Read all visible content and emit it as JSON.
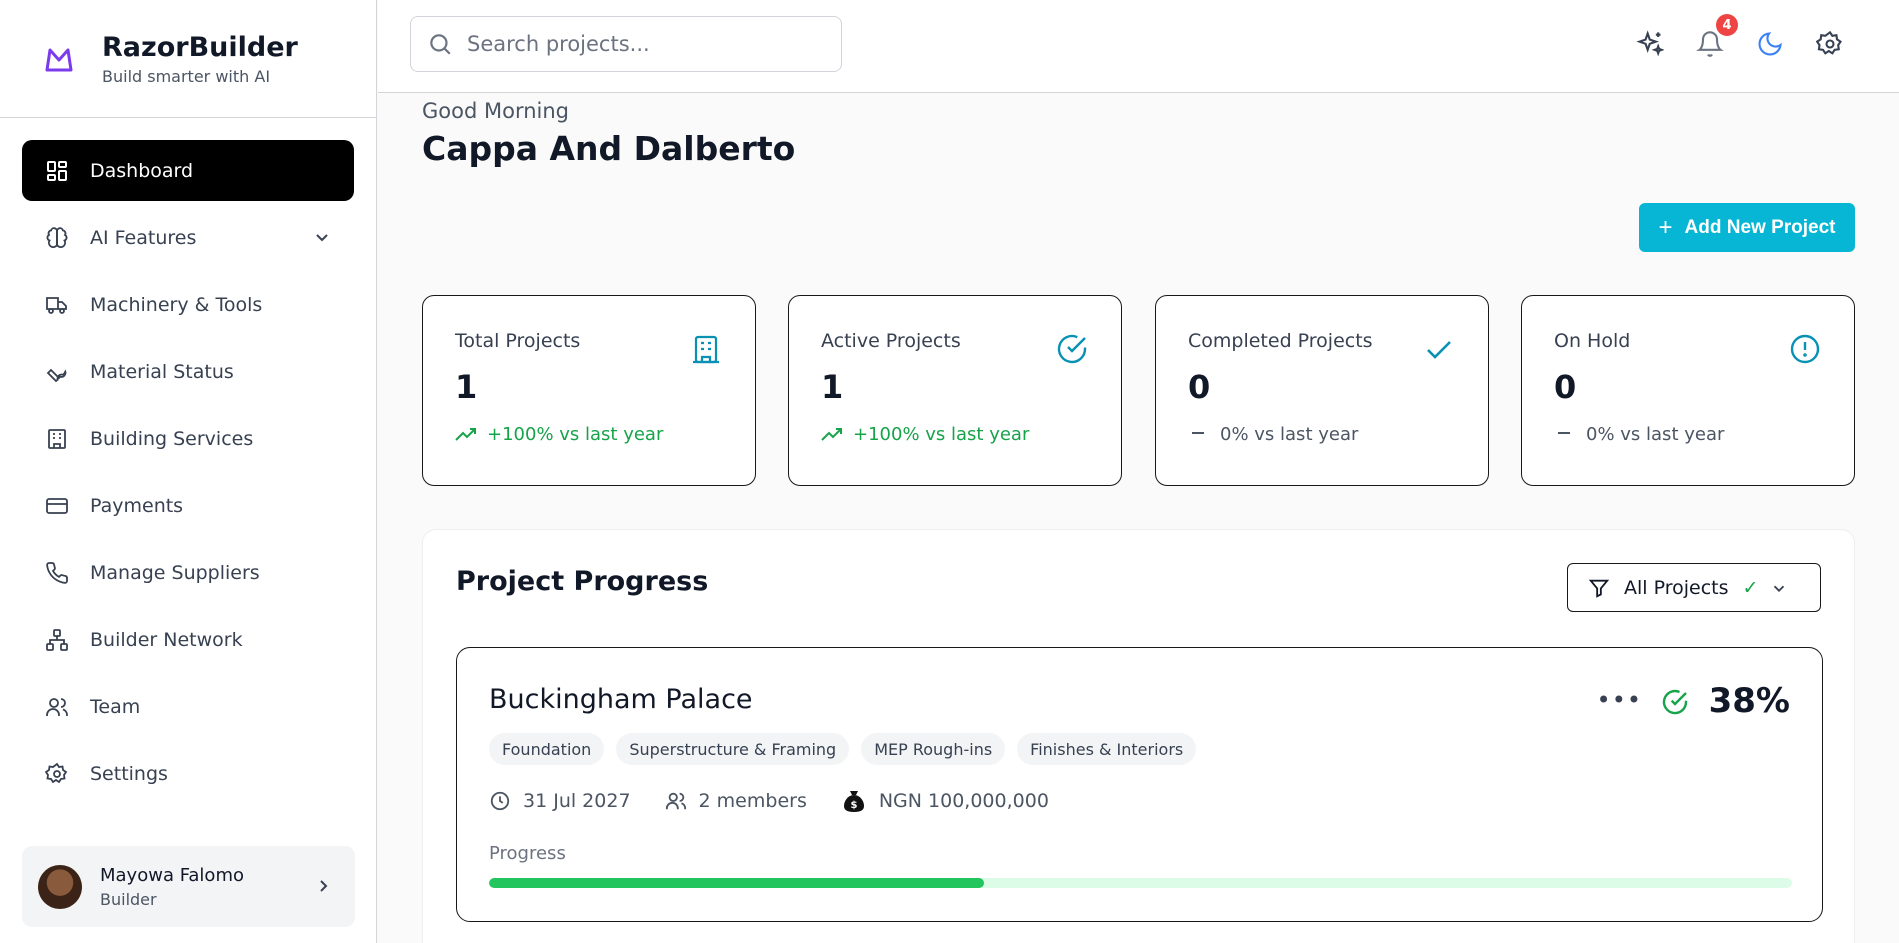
{
  "brand": {
    "name": "RazorBuilder",
    "tagline": "Build smarter with AI"
  },
  "sidebar": {
    "items": [
      {
        "label": "Dashboard",
        "icon": "dashboard-icon",
        "active": true
      },
      {
        "label": "AI Features",
        "icon": "brain-icon",
        "expandable": true
      },
      {
        "label": "Machinery & Tools",
        "icon": "truck-icon"
      },
      {
        "label": "Material Status",
        "icon": "wrench-icon"
      },
      {
        "label": "Building Services",
        "icon": "building-icon"
      },
      {
        "label": "Payments",
        "icon": "credit-card-icon"
      },
      {
        "label": "Manage Suppliers",
        "icon": "phone-icon"
      },
      {
        "label": "Builder Network",
        "icon": "network-icon"
      },
      {
        "label": "Team",
        "icon": "users-icon"
      },
      {
        "label": "Settings",
        "icon": "gear-icon"
      }
    ]
  },
  "user": {
    "name": "Mayowa Falomo",
    "role": "Builder"
  },
  "header": {
    "search_placeholder": "Search projects...",
    "notification_count": "4"
  },
  "main": {
    "greeting": "Good Morning",
    "title": "Cappa And Dalberto",
    "add_button_label": "Add New Project",
    "stats": [
      {
        "label": "Total Projects",
        "value": "1",
        "trend": "+100% vs last year",
        "trend_type": "up",
        "icon": "building-icon",
        "icon_color": "#0891b2"
      },
      {
        "label": "Active Projects",
        "value": "1",
        "trend": "+100% vs last year",
        "trend_type": "up",
        "icon": "check-circle-icon",
        "icon_color": "#0891b2"
      },
      {
        "label": "Completed Projects",
        "value": "0",
        "trend": "0% vs last year",
        "trend_type": "flat",
        "icon": "check-icon",
        "icon_color": "#0891b2"
      },
      {
        "label": "On Hold",
        "value": "0",
        "trend": "0% vs last year",
        "trend_type": "flat",
        "icon": "alert-circle-icon",
        "icon_color": "#0891b2"
      }
    ],
    "progress_section": {
      "title": "Project Progress",
      "filter_label": "All Projects",
      "filter_check": "✓"
    },
    "project": {
      "name": "Buckingham Palace",
      "percent_label": "38%",
      "progress_value": 0.38,
      "tags": [
        "Foundation",
        "Superstructure & Framing",
        "MEP Rough-ins",
        "Finishes & Interiors"
      ],
      "due_date": "31 Jul 2027",
      "members": "2 members",
      "budget": "NGN 100,000,000",
      "progress_label": "Progress"
    }
  },
  "colors": {
    "accent": "#06b6d4",
    "success": "#22c55e",
    "brand_purple": "#7c3aed",
    "badge_red": "#ef4444"
  }
}
